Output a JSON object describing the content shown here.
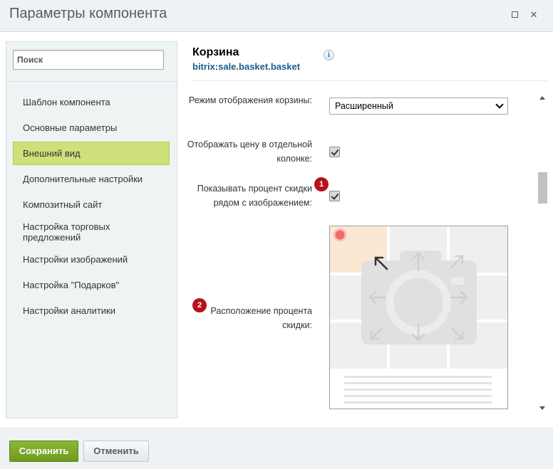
{
  "window": {
    "title": "Параметры компонента",
    "maximize_glyph": "☐",
    "close_glyph": "✕"
  },
  "sidebar": {
    "search_placeholder": "Поиск",
    "items": [
      {
        "label": "Шаблон компонента"
      },
      {
        "label": "Основные параметры"
      },
      {
        "label": "Внешний вид",
        "active": true
      },
      {
        "label": "Дополнительные настройки"
      },
      {
        "label": "Композитный сайт"
      },
      {
        "label": "Настройка торговых предложений"
      },
      {
        "label": "Настройки изображений"
      },
      {
        "label": "Настройка \"Подарков\""
      },
      {
        "label": "Настройки аналитики"
      }
    ]
  },
  "component": {
    "title": "Корзина",
    "code": "bitrix:sale.basket.basket",
    "info_glyph": "i"
  },
  "form": {
    "display_mode": {
      "label": "Режим отображения корзины:",
      "value": "Расширенный"
    },
    "price_column": {
      "label": "Отображать цену в отдельной колонке:",
      "checked": true
    },
    "discount_percent": {
      "label": "Показывать процент скидки рядом с изображением:",
      "checked": true,
      "badge": "1"
    },
    "discount_position": {
      "label": "Расположение процента скидки:",
      "badge": "2",
      "selected_corner": "top-left"
    }
  },
  "footer": {
    "save_label": "Сохранить",
    "cancel_label": "Отменить"
  },
  "colors": {
    "active_nav": "#cde07a",
    "badge": "#b5111b",
    "save_button": "#7aa72a",
    "link": "#1d5c8c"
  }
}
